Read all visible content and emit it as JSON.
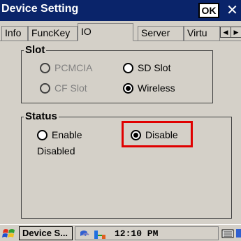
{
  "window": {
    "title": "Device Setting",
    "ok_label": "OK",
    "close_glyph": "✕"
  },
  "tabs": [
    {
      "label": "Info",
      "active": false
    },
    {
      "label": "FuncKey",
      "active": false
    },
    {
      "label": "IO",
      "active": true
    },
    {
      "label": "Server",
      "active": false
    },
    {
      "label": "Virtu",
      "active": false
    }
  ],
  "tab_scroll": {
    "left_glyph": "◀",
    "right_glyph": "▶"
  },
  "slot_group": {
    "title": "Slot",
    "options": [
      {
        "label": "PCMCIA",
        "selected": false,
        "enabled": false
      },
      {
        "label": "SD Slot",
        "selected": false,
        "enabled": true
      },
      {
        "label": "CF Slot",
        "selected": false,
        "enabled": false
      },
      {
        "label": "Wireless",
        "selected": true,
        "enabled": true
      }
    ]
  },
  "status_group": {
    "title": "Status",
    "options": [
      {
        "label": "Enable",
        "selected": false
      },
      {
        "label": "Disable",
        "selected": true
      }
    ],
    "status_text": "Disabled"
  },
  "taskbar": {
    "task_label": "Device S...",
    "clock": "12:10 PM"
  },
  "colors": {
    "titlebar": "#0a246a",
    "panel": "#d4d0c8",
    "highlight": "#e00000"
  }
}
